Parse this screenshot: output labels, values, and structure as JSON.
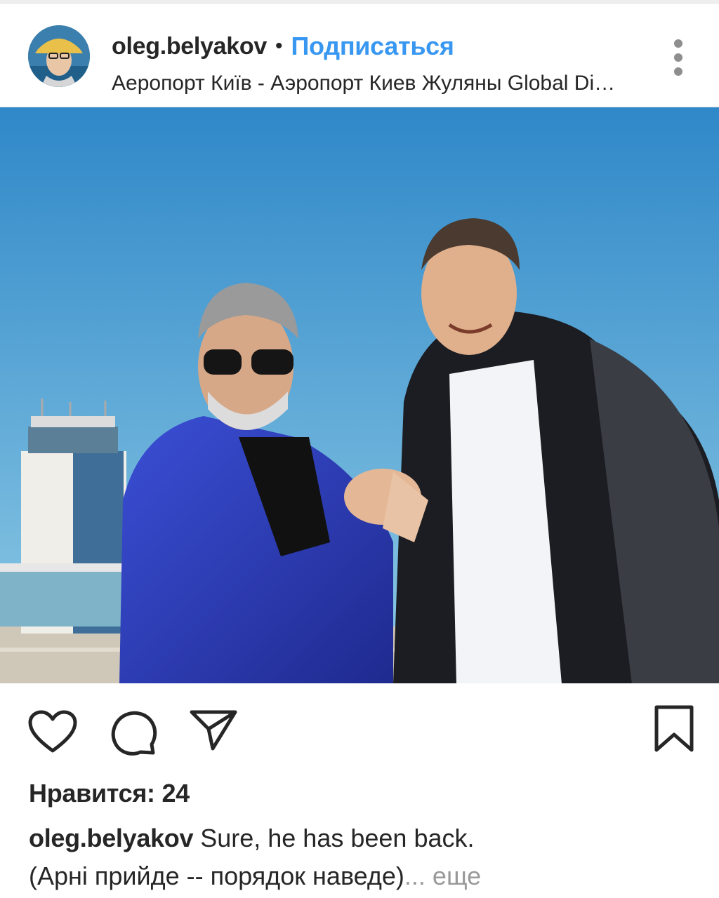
{
  "post": {
    "username": "oleg.belyakov",
    "separator": "•",
    "follow_label": "Подписаться",
    "location": "Аеропорт Київ - Аэропорт Киев Жуляны Global Di…",
    "photo_icon": "photo-image",
    "likes_text": "Нравится: 24",
    "caption_user": "oleg.belyakov",
    "caption_line1": "Sure, he has been back.",
    "caption_line2": "(Арні прийде -- порядок наведе)",
    "caption_more": "... еще"
  },
  "icons": {
    "like": "heart-icon",
    "comment": "comment-bubble-icon",
    "share": "paper-plane-icon",
    "save": "bookmark-icon",
    "menu": "more-vertical-icon"
  },
  "colors": {
    "accent": "#3897f0",
    "text": "#262626",
    "muted": "#999999",
    "sky": "#3c96cf"
  }
}
